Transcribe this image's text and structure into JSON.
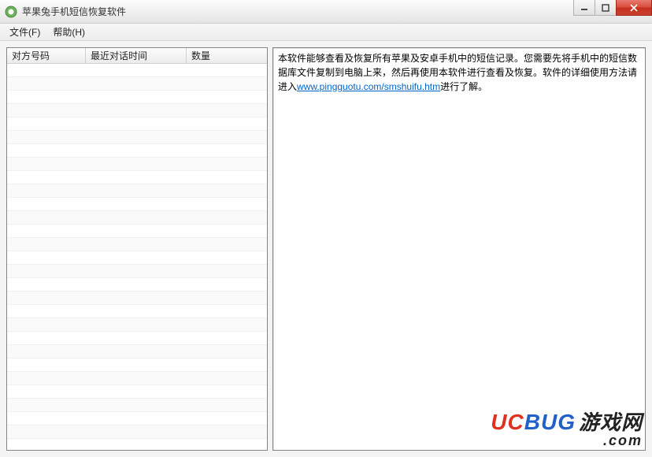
{
  "window": {
    "title": "苹果兔手机短信恢复软件"
  },
  "menu": {
    "file": "文件(F)",
    "help": "帮助(H)"
  },
  "table": {
    "columns": {
      "col1": "对方号码",
      "col2": "最近对话时间",
      "col3": "数量"
    }
  },
  "info": {
    "text1": "本软件能够查看及恢复所有苹果及安卓手机中的短信记录。您需要先将手机中的短信数据库文件复制到电脑上来，然后再使用本软件进行查看及恢复。软件的详细使用方法请进入",
    "link_text": "www.pingguotu.com/smshuifu.htm",
    "link_href": "http://www.pingguotu.com/smshuifu.htm",
    "text2": "进行了解。"
  },
  "watermark": {
    "uc": "UC",
    "bug": "BUG",
    "cn": "游戏网",
    "com": ".com"
  }
}
